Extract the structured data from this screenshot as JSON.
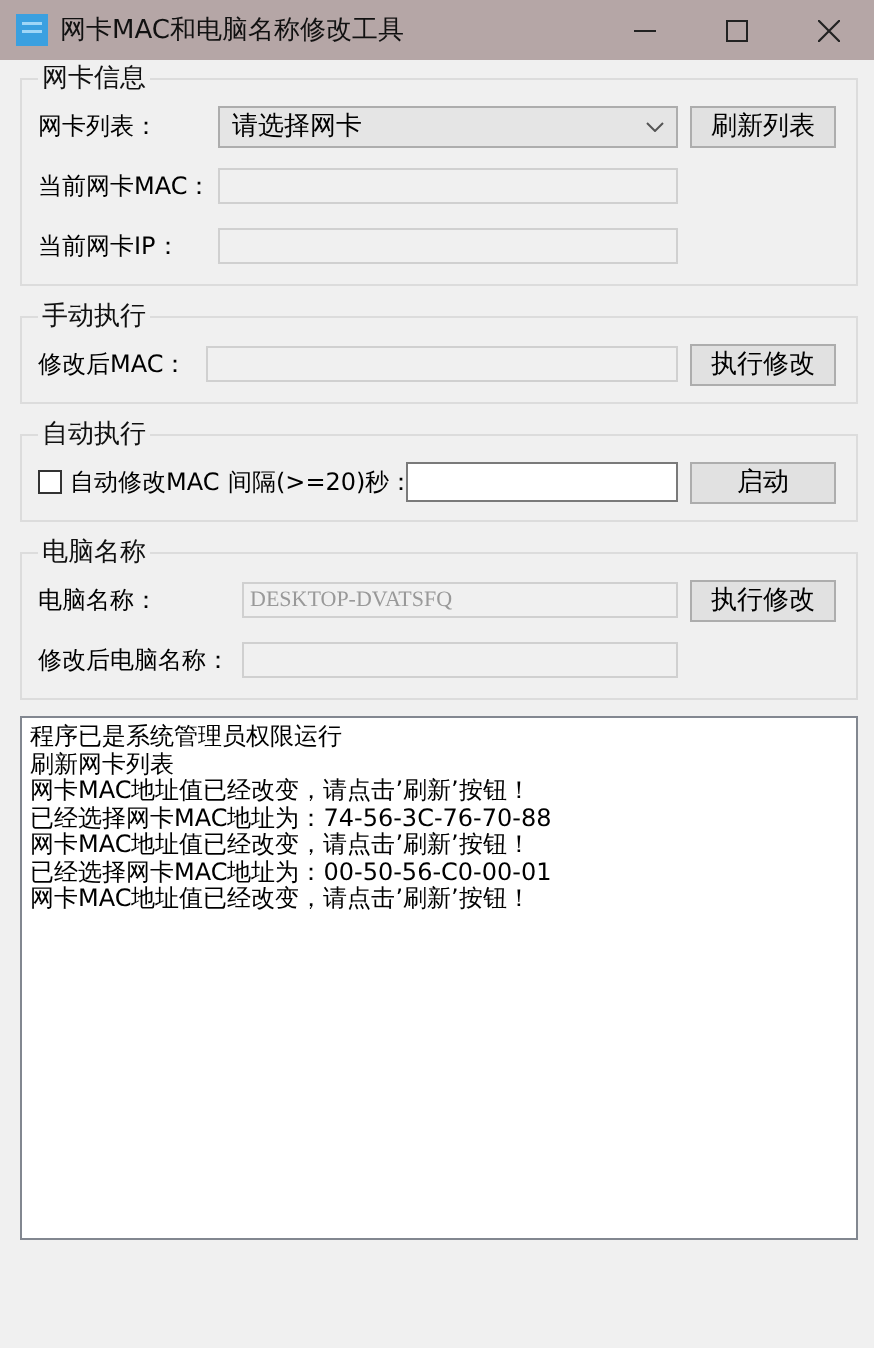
{
  "window": {
    "title": "网卡MAC和电脑名称修改工具"
  },
  "adapter_info": {
    "title": "网卡信息",
    "list_label": "网卡列表：",
    "list_value": "请选择网卡",
    "refresh_button": "刷新列表",
    "mac_label": "当前网卡MAC：",
    "ip_label": "当前网卡IP："
  },
  "manual": {
    "title": "手动执行",
    "mac_label": "修改后MAC：",
    "execute_button": "执行修改"
  },
  "auto": {
    "title": "自动执行",
    "checkbox_label": "自动修改MAC",
    "checked": false,
    "interval_label": "间隔(>=20)秒：",
    "start_button": "启动"
  },
  "computer_name": {
    "title": "电脑名称",
    "name_label": "电脑名称：",
    "name_value": "DESKTOP-DVATSFQ",
    "execute_button": "执行修改",
    "new_name_label": "修改后电脑名称："
  },
  "log": {
    "lines": [
      "程序已是系统管理员权限运行",
      "刷新网卡列表",
      "网卡MAC地址值已经改变，请点击’刷新’按钮！",
      "已经选择网卡MAC地址为：74-56-3C-76-70-88",
      "网卡MAC地址值已经改变，请点击’刷新’按钮！",
      "已经选择网卡MAC地址为：00-50-56-C0-00-01",
      "网卡MAC地址值已经改变，请点击’刷新’按钮！"
    ]
  }
}
